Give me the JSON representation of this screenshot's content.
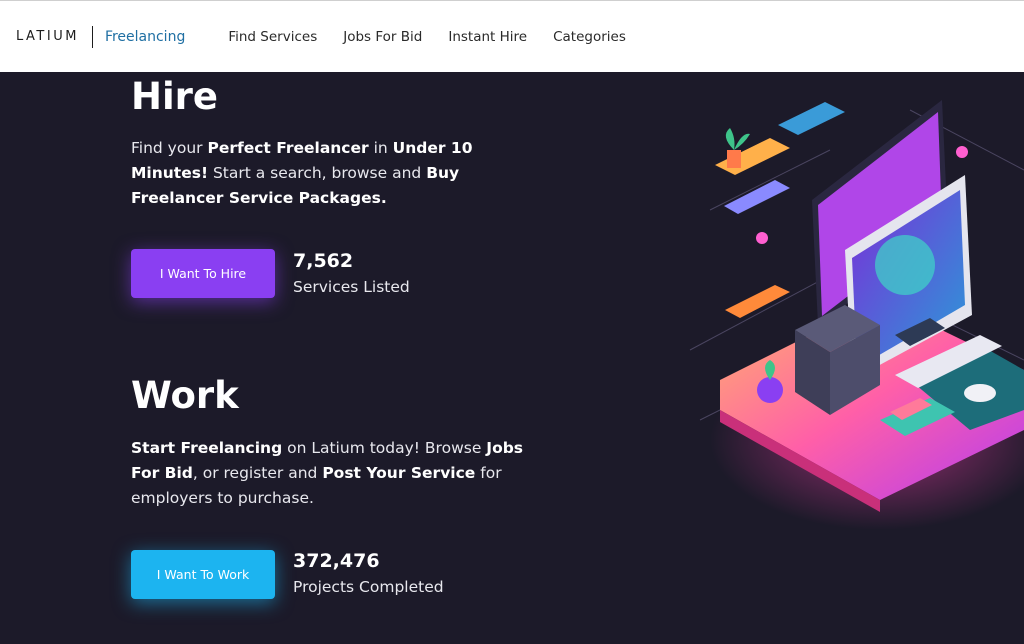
{
  "header": {
    "logo": "LATIUM",
    "logo_sub": "Freelancing",
    "nav": [
      "Find Services",
      "Jobs For Bid",
      "Instant Hire",
      "Categories"
    ]
  },
  "hire": {
    "title": "Hire",
    "text_parts": [
      "Find your ",
      "Perfect Freelancer",
      " in ",
      "Under 10 Minutes!",
      " Start a search, browse and ",
      "Buy Freelancer Service Packages."
    ],
    "button": "I Want To Hire",
    "stat_number": "7,562",
    "stat_label": "Services Listed"
  },
  "work": {
    "title": "Work",
    "text_parts": [
      "Start Freelancing",
      " on Latium today! Browse ",
      "Jobs For Bid",
      ", or register and ",
      "Post Your Service",
      " for employers to purchase."
    ],
    "button": "I Want To Work",
    "stat_number": "372,476",
    "stat_label": "Projects Completed"
  },
  "colors": {
    "background": "#1c1a29",
    "hire_button": "#8a3ff2",
    "work_button": "#1cb4f0",
    "brand_sub": "#1f6fa3"
  }
}
